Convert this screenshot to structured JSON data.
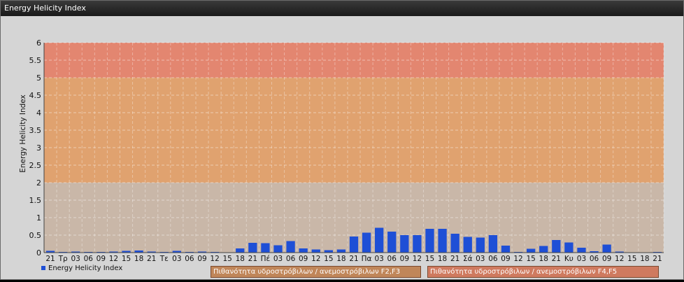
{
  "window": {
    "title": "Energy Helicity Index"
  },
  "colors": {
    "bar": "#1e4fd6",
    "band_low": "#c9b7a8",
    "band_mid": "#e0a26f",
    "band_high": "#e38670",
    "label_mid_bg": "#c08659",
    "label_high_bg": "#cf7a5f"
  },
  "legend": {
    "series": "Energy Helicity Index",
    "band_mid": "Πιθανότητα υδροστρόβιλων / ανεμοστρόβιλων F2,F3",
    "band_high": "Πιθανότητα υδροστρόβιλων / ανεμοστρόβιλων F4,F5"
  },
  "chart_data": {
    "type": "bar",
    "title": "",
    "ylabel": "Energy Helicity Index",
    "xlabel": "",
    "ylim": [
      0,
      6
    ],
    "yticks": [
      0,
      0.5,
      1,
      1.5,
      2,
      2.5,
      3,
      3.5,
      4,
      4.5,
      5,
      5.5,
      6
    ],
    "ytick_labels": [
      "0",
      "0.5",
      "1",
      "1.5",
      "2",
      "2.5",
      "3",
      "3.5",
      "4",
      "4.5",
      "5",
      "5.5",
      "6"
    ],
    "bands": [
      {
        "from": 2,
        "to": 5
      },
      {
        "from": 5,
        "to": 6
      }
    ],
    "grid": true,
    "categories": [
      "21",
      "Τρ",
      "03",
      "06",
      "09",
      "12",
      "15",
      "18",
      "21",
      "Τε",
      "03",
      "06",
      "09",
      "12",
      "15",
      "18",
      "21",
      "Πέ",
      "03",
      "06",
      "09",
      "12",
      "15",
      "18",
      "21",
      "Πα",
      "03",
      "06",
      "09",
      "12",
      "15",
      "18",
      "21",
      "Σά",
      "03",
      "06",
      "09",
      "12",
      "15",
      "18",
      "21",
      "Κυ",
      "03",
      "06",
      "09",
      "12",
      "15",
      "18",
      "21"
    ],
    "series": [
      {
        "name": "Energy Helicity Index",
        "values": [
          0.05,
          0.02,
          0.03,
          0.02,
          0.02,
          0.03,
          0.05,
          0.06,
          0.03,
          0.02,
          0.05,
          0.02,
          0.03,
          0.02,
          0.01,
          0.12,
          0.28,
          0.27,
          0.21,
          0.33,
          0.12,
          0.09,
          0.07,
          0.09,
          0.46,
          0.57,
          0.71,
          0.6,
          0.5,
          0.5,
          0.68,
          0.68,
          0.54,
          0.45,
          0.43,
          0.5,
          0.2,
          0.02,
          0.11,
          0.19,
          0.36,
          0.29,
          0.14,
          0.04,
          0.23,
          0.03,
          0.01,
          0.01,
          0.02
        ]
      }
    ]
  }
}
